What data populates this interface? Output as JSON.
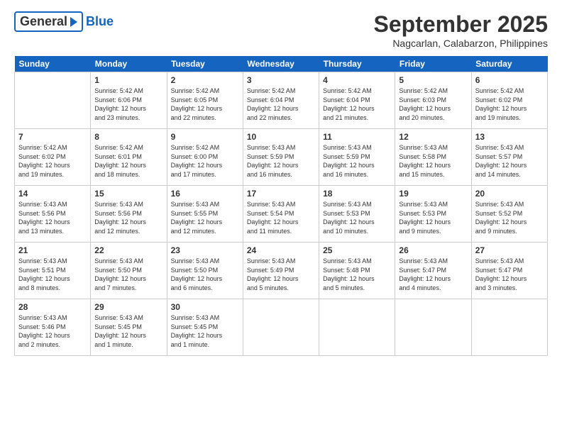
{
  "header": {
    "logo_general": "General",
    "logo_blue": "Blue",
    "month_title": "September 2025",
    "location": "Nagcarlan, Calabarzon, Philippines"
  },
  "days_of_week": [
    "Sunday",
    "Monday",
    "Tuesday",
    "Wednesday",
    "Thursday",
    "Friday",
    "Saturday"
  ],
  "weeks": [
    [
      {
        "day": "",
        "text": ""
      },
      {
        "day": "1",
        "text": "Sunrise: 5:42 AM\nSunset: 6:06 PM\nDaylight: 12 hours\nand 23 minutes."
      },
      {
        "day": "2",
        "text": "Sunrise: 5:42 AM\nSunset: 6:05 PM\nDaylight: 12 hours\nand 22 minutes."
      },
      {
        "day": "3",
        "text": "Sunrise: 5:42 AM\nSunset: 6:04 PM\nDaylight: 12 hours\nand 22 minutes."
      },
      {
        "day": "4",
        "text": "Sunrise: 5:42 AM\nSunset: 6:04 PM\nDaylight: 12 hours\nand 21 minutes."
      },
      {
        "day": "5",
        "text": "Sunrise: 5:42 AM\nSunset: 6:03 PM\nDaylight: 12 hours\nand 20 minutes."
      },
      {
        "day": "6",
        "text": "Sunrise: 5:42 AM\nSunset: 6:02 PM\nDaylight: 12 hours\nand 19 minutes."
      }
    ],
    [
      {
        "day": "7",
        "text": "Sunrise: 5:42 AM\nSunset: 6:02 PM\nDaylight: 12 hours\nand 19 minutes."
      },
      {
        "day": "8",
        "text": "Sunrise: 5:42 AM\nSunset: 6:01 PM\nDaylight: 12 hours\nand 18 minutes."
      },
      {
        "day": "9",
        "text": "Sunrise: 5:42 AM\nSunset: 6:00 PM\nDaylight: 12 hours\nand 17 minutes."
      },
      {
        "day": "10",
        "text": "Sunrise: 5:43 AM\nSunset: 5:59 PM\nDaylight: 12 hours\nand 16 minutes."
      },
      {
        "day": "11",
        "text": "Sunrise: 5:43 AM\nSunset: 5:59 PM\nDaylight: 12 hours\nand 16 minutes."
      },
      {
        "day": "12",
        "text": "Sunrise: 5:43 AM\nSunset: 5:58 PM\nDaylight: 12 hours\nand 15 minutes."
      },
      {
        "day": "13",
        "text": "Sunrise: 5:43 AM\nSunset: 5:57 PM\nDaylight: 12 hours\nand 14 minutes."
      }
    ],
    [
      {
        "day": "14",
        "text": "Sunrise: 5:43 AM\nSunset: 5:56 PM\nDaylight: 12 hours\nand 13 minutes."
      },
      {
        "day": "15",
        "text": "Sunrise: 5:43 AM\nSunset: 5:56 PM\nDaylight: 12 hours\nand 12 minutes."
      },
      {
        "day": "16",
        "text": "Sunrise: 5:43 AM\nSunset: 5:55 PM\nDaylight: 12 hours\nand 12 minutes."
      },
      {
        "day": "17",
        "text": "Sunrise: 5:43 AM\nSunset: 5:54 PM\nDaylight: 12 hours\nand 11 minutes."
      },
      {
        "day": "18",
        "text": "Sunrise: 5:43 AM\nSunset: 5:53 PM\nDaylight: 12 hours\nand 10 minutes."
      },
      {
        "day": "19",
        "text": "Sunrise: 5:43 AM\nSunset: 5:53 PM\nDaylight: 12 hours\nand 9 minutes."
      },
      {
        "day": "20",
        "text": "Sunrise: 5:43 AM\nSunset: 5:52 PM\nDaylight: 12 hours\nand 9 minutes."
      }
    ],
    [
      {
        "day": "21",
        "text": "Sunrise: 5:43 AM\nSunset: 5:51 PM\nDaylight: 12 hours\nand 8 minutes."
      },
      {
        "day": "22",
        "text": "Sunrise: 5:43 AM\nSunset: 5:50 PM\nDaylight: 12 hours\nand 7 minutes."
      },
      {
        "day": "23",
        "text": "Sunrise: 5:43 AM\nSunset: 5:50 PM\nDaylight: 12 hours\nand 6 minutes."
      },
      {
        "day": "24",
        "text": "Sunrise: 5:43 AM\nSunset: 5:49 PM\nDaylight: 12 hours\nand 5 minutes."
      },
      {
        "day": "25",
        "text": "Sunrise: 5:43 AM\nSunset: 5:48 PM\nDaylight: 12 hours\nand 5 minutes."
      },
      {
        "day": "26",
        "text": "Sunrise: 5:43 AM\nSunset: 5:47 PM\nDaylight: 12 hours\nand 4 minutes."
      },
      {
        "day": "27",
        "text": "Sunrise: 5:43 AM\nSunset: 5:47 PM\nDaylight: 12 hours\nand 3 minutes."
      }
    ],
    [
      {
        "day": "28",
        "text": "Sunrise: 5:43 AM\nSunset: 5:46 PM\nDaylight: 12 hours\nand 2 minutes."
      },
      {
        "day": "29",
        "text": "Sunrise: 5:43 AM\nSunset: 5:45 PM\nDaylight: 12 hours\nand 1 minute."
      },
      {
        "day": "30",
        "text": "Sunrise: 5:43 AM\nSunset: 5:45 PM\nDaylight: 12 hours\nand 1 minute."
      },
      {
        "day": "",
        "text": ""
      },
      {
        "day": "",
        "text": ""
      },
      {
        "day": "",
        "text": ""
      },
      {
        "day": "",
        "text": ""
      }
    ]
  ]
}
